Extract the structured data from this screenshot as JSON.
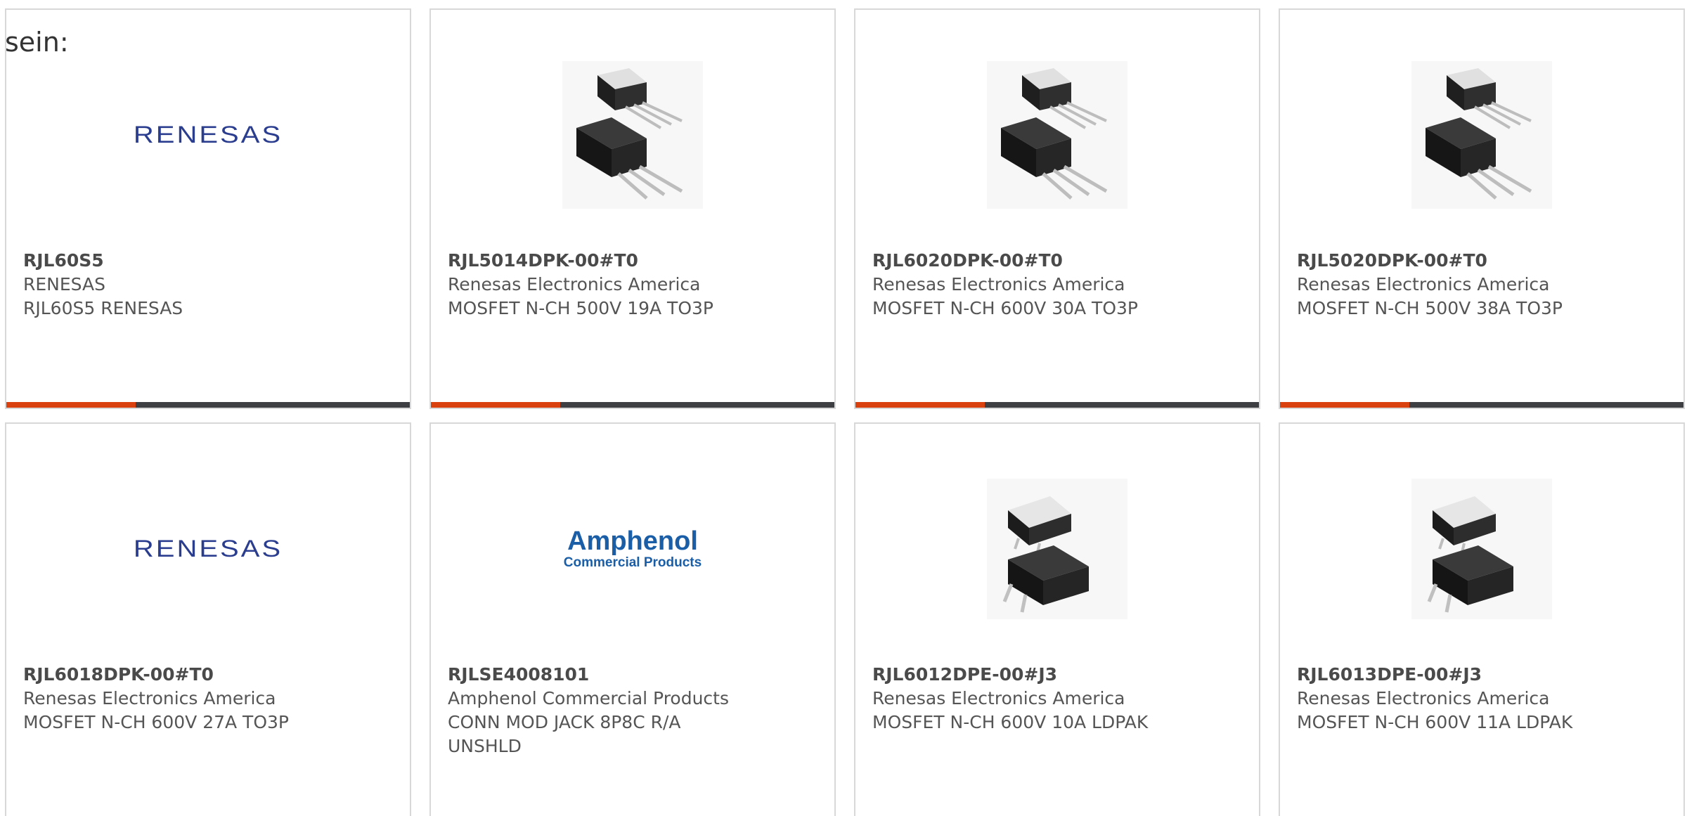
{
  "intro_text": "sein:",
  "accent_color": "#d9410f",
  "bar_color": "#3d3f42",
  "products": [
    {
      "part_number": "RJL60S5",
      "manufacturer": "RENESAS",
      "description": "RJL60S5 RENESAS",
      "image": "renesas-logo",
      "logo_text": "RENESAS"
    },
    {
      "part_number": "RJL5014DPK-00#T0",
      "manufacturer": "Renesas Electronics America",
      "description": "MOSFET N-CH 500V 19A TO3P",
      "image": "to3p-package"
    },
    {
      "part_number": "RJL6020DPK-00#T0",
      "manufacturer": "Renesas Electronics America",
      "description": "MOSFET N-CH 600V 30A TO3P",
      "image": "to3p-package"
    },
    {
      "part_number": "RJL5020DPK-00#T0",
      "manufacturer": "Renesas Electronics America",
      "description": "MOSFET N-CH 500V 38A TO3P",
      "image": "to3p-package"
    },
    {
      "part_number": "RJL6018DPK-00#T0",
      "manufacturer": "Renesas Electronics America",
      "description": "MOSFET N-CH 600V 27A TO3P",
      "image": "renesas-logo",
      "logo_text": "RENESAS"
    },
    {
      "part_number": "RJLSE4008101",
      "manufacturer": "Amphenol Commercial Products",
      "description": "CONN MOD JACK 8P8C R/A UNSHLD",
      "image": "amphenol-logo",
      "logo_text": "Amphenol",
      "logo_subtext": "Commercial Products"
    },
    {
      "part_number": "RJL6012DPE-00#J3",
      "manufacturer": "Renesas Electronics America",
      "description": "MOSFET N-CH 600V 10A LDPAK",
      "image": "ldpak-package"
    },
    {
      "part_number": "RJL6013DPE-00#J3",
      "manufacturer": "Renesas Electronics America",
      "description": "MOSFET N-CH 600V 11A LDPAK",
      "image": "ldpak-package"
    }
  ]
}
